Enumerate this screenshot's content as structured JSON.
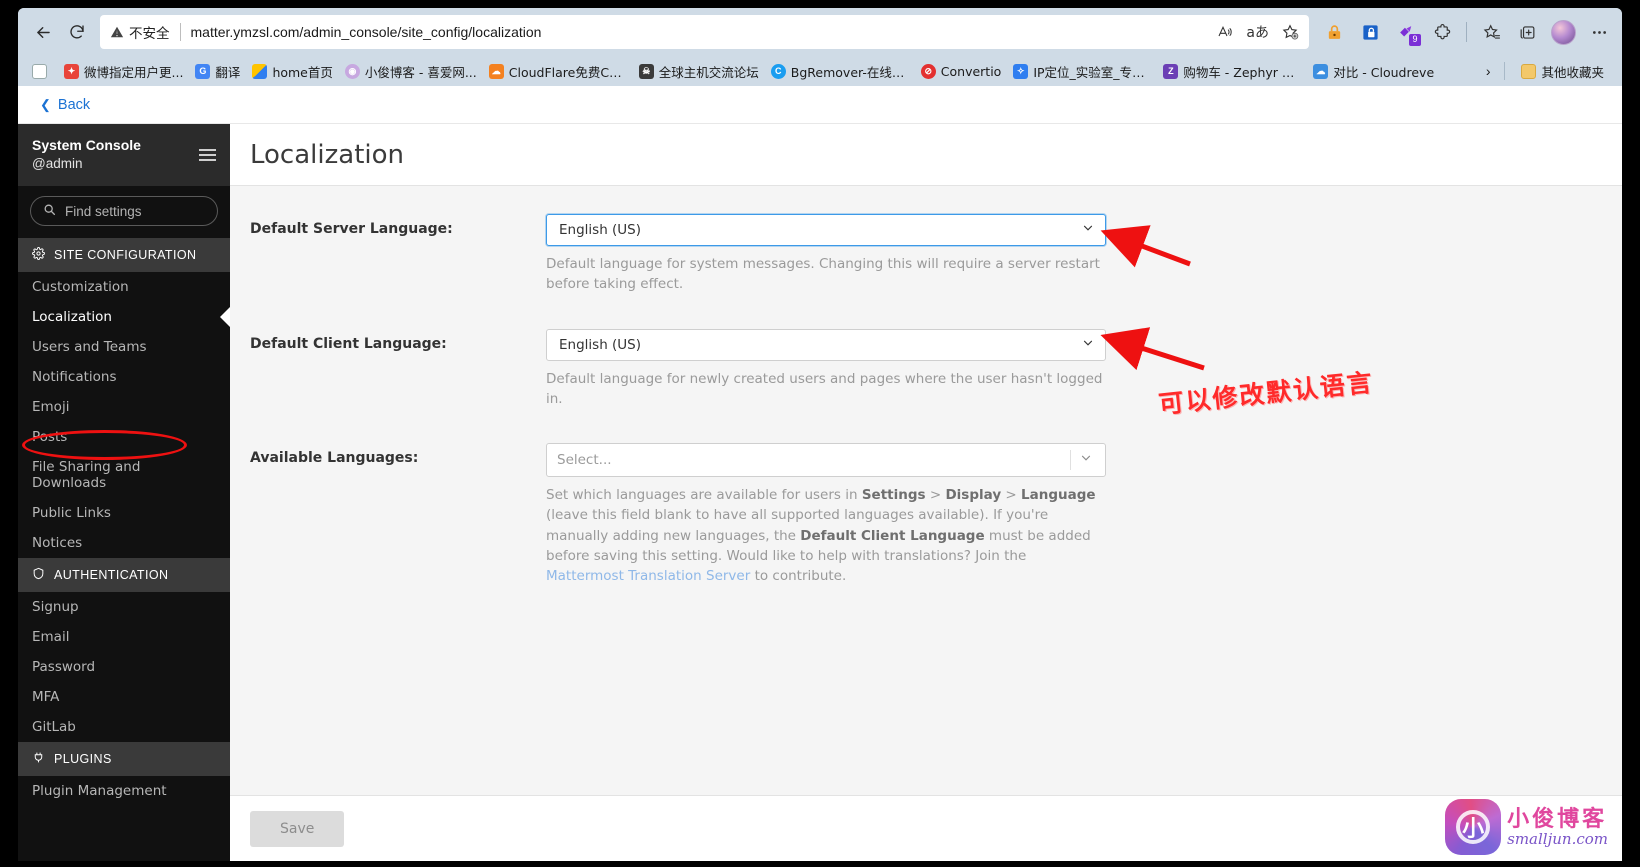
{
  "browser": {
    "back_icon": "back-arrow-icon",
    "reload_icon": "reload-icon",
    "security_label": "不安全",
    "url": "matter.ymzsl.com/admin_console/site_config/localization",
    "omnibox_actions": [
      {
        "name": "read-aloud-icon",
        "glyph": "A"
      },
      {
        "name": "translate-icon",
        "glyph": "aあ"
      },
      {
        "name": "add-favorite-icon",
        "glyph": "☆"
      }
    ],
    "toolbar_icons": [
      {
        "name": "lock-extension-icon"
      },
      {
        "name": "shield-extension-icon"
      },
      {
        "name": "purple-extension-icon",
        "badge": "9"
      },
      {
        "name": "extensions-puzzle-icon"
      },
      {
        "name": "favorites-icon"
      },
      {
        "name": "collections-icon"
      },
      {
        "name": "profile-avatar"
      },
      {
        "name": "settings-more-icon"
      }
    ],
    "bookmarks": [
      {
        "label": "",
        "icon": "page-icon"
      },
      {
        "label": "微博指定用户更...",
        "icon": "weibo-icon"
      },
      {
        "label": "翻译",
        "icon": "google-translate-icon"
      },
      {
        "label": "home首页",
        "icon": "home-icon"
      },
      {
        "label": "小俊博客 - 喜爱网...",
        "icon": "blog-icon"
      },
      {
        "label": "CloudFlare免费CD...",
        "icon": "cloudflare-icon"
      },
      {
        "label": "全球主机交流论坛",
        "icon": "forum-icon"
      },
      {
        "label": "BgRemover-在线图...",
        "icon": "bgremover-icon"
      },
      {
        "label": "Convertio",
        "icon": "convertio-icon"
      },
      {
        "label": "IP定位_实验室_专业...",
        "icon": "ip-locate-icon"
      },
      {
        "label": "购物车 - Zephyr Sh...",
        "icon": "zephyr-icon"
      },
      {
        "label": "对比 - Cloudreve",
        "icon": "cloudreve-icon"
      }
    ],
    "bookmarks_overflow_icon": "chevron-right-icon",
    "other_bookmarks_label": "其他收藏夹",
    "other_bookmarks_icon": "folder-icon"
  },
  "page": {
    "back_label": "Back",
    "title": "Localization"
  },
  "sidebar": {
    "title": "System Console",
    "subtitle": "@admin",
    "hamburger_icon": "hamburger-menu-icon",
    "search_placeholder": "Find settings",
    "search_icon": "search-icon",
    "groups": [
      {
        "label": "SITE CONFIGURATION",
        "icon": "gear-icon",
        "items": [
          {
            "label": "Customization",
            "active": false
          },
          {
            "label": "Localization",
            "active": true
          },
          {
            "label": "Users and Teams",
            "active": false
          },
          {
            "label": "Notifications",
            "active": false
          },
          {
            "label": "Emoji",
            "active": false
          },
          {
            "label": "Posts",
            "active": false
          },
          {
            "label": "File Sharing and Downloads",
            "active": false
          },
          {
            "label": "Public Links",
            "active": false
          },
          {
            "label": "Notices",
            "active": false
          }
        ]
      },
      {
        "label": "AUTHENTICATION",
        "icon": "shield-icon",
        "items": [
          {
            "label": "Signup",
            "active": false
          },
          {
            "label": "Email",
            "active": false
          },
          {
            "label": "Password",
            "active": false
          },
          {
            "label": "MFA",
            "active": false
          },
          {
            "label": "GitLab",
            "active": false
          }
        ]
      },
      {
        "label": "PLUGINS",
        "icon": "plugin-icon",
        "items": [
          {
            "label": "Plugin Management",
            "active": false
          }
        ]
      }
    ]
  },
  "form": {
    "server_language": {
      "label": "Default Server Language:",
      "value": "English (US)",
      "help": "Default language for system messages. Changing this will require a server restart before taking effect."
    },
    "client_language": {
      "label": "Default Client Language:",
      "value": "English (US)",
      "help": "Default language for newly created users and pages where the user hasn't logged in."
    },
    "available_languages": {
      "label": "Available Languages:",
      "placeholder": "Select...",
      "help_1": "Set which languages are available for users in ",
      "help_b1": "Settings",
      "help_sep1": " > ",
      "help_b2": "Display",
      "help_sep2": " > ",
      "help_b3": "Language",
      "help_2": " (leave this field blank to have all supported languages available). If you're manually adding new languages, the ",
      "help_b4": "Default Client Language",
      "help_3": " must be added before saving this setting. Would like to help with translations? Join the ",
      "help_link": "Mattermost Translation Server",
      "help_4": " to contribute."
    },
    "save_label": "Save"
  },
  "annotations": {
    "note_text": "可以修改默认语言",
    "note_color": "#ff2a2a",
    "arrow_color": "#ee1111",
    "ellipse_target": "Localization"
  },
  "watermark": {
    "cn": "小俊博客",
    "en": "smalljun.com",
    "logo_glyph": "小"
  }
}
